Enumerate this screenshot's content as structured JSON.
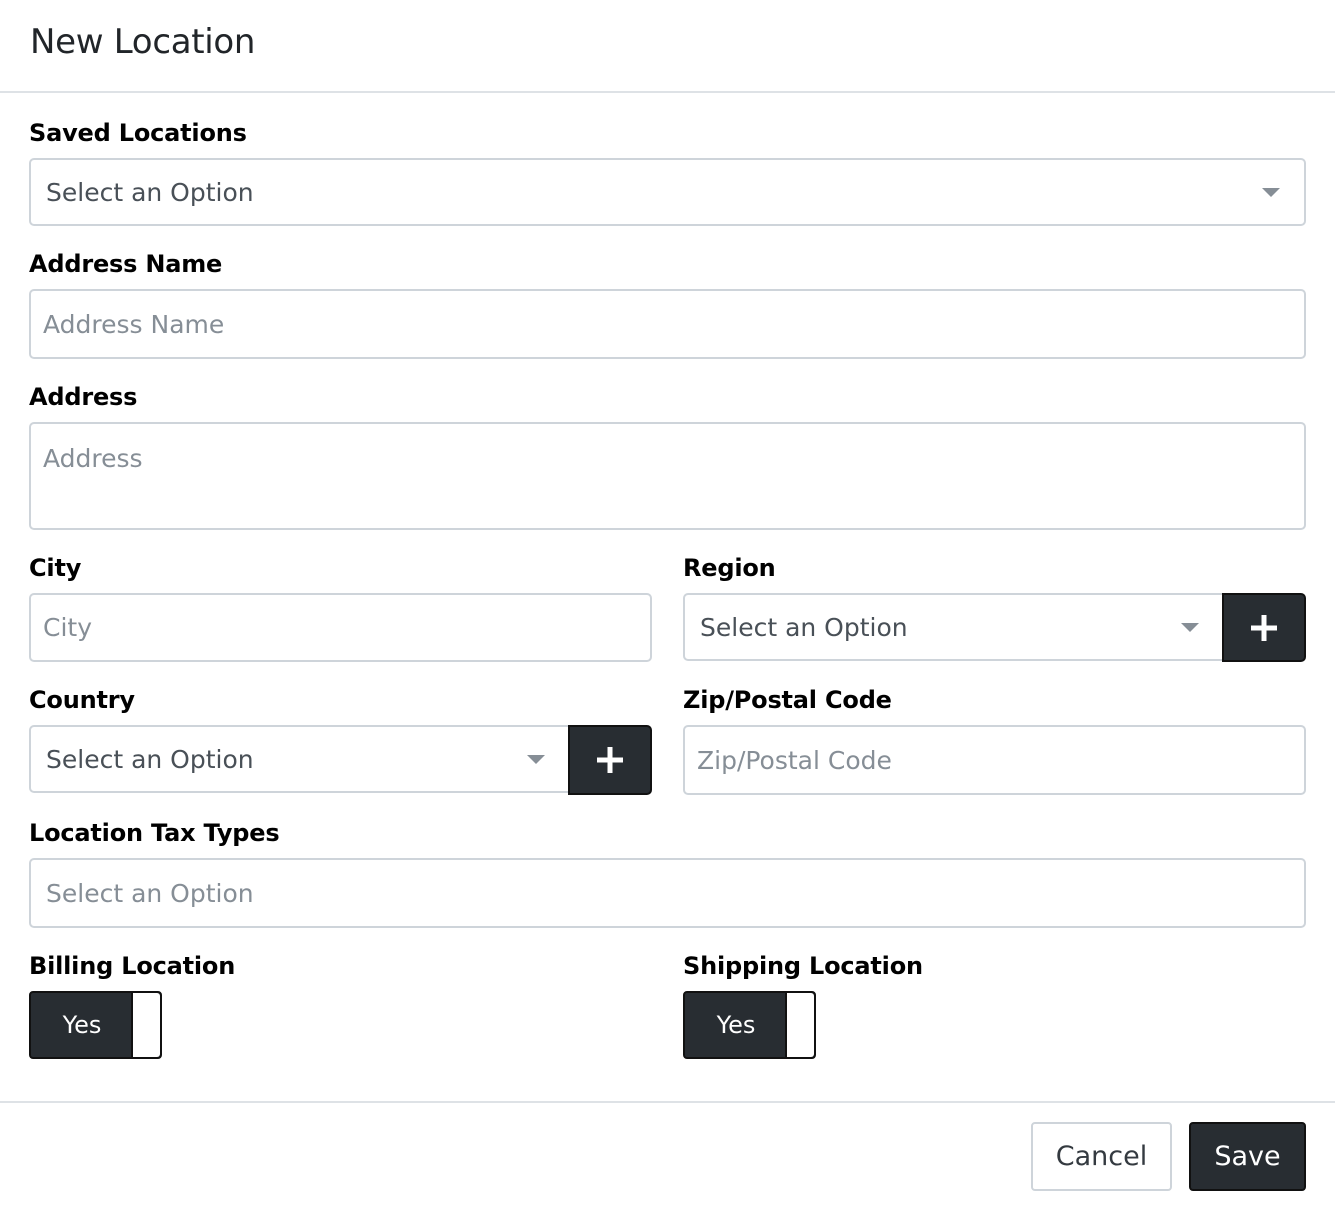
{
  "modal": {
    "title": "New Location"
  },
  "form": {
    "saved_locations": {
      "label": "Saved Locations",
      "value": "Select an Option"
    },
    "address_name": {
      "label": "Address Name",
      "placeholder": "Address Name"
    },
    "address": {
      "label": "Address",
      "placeholder": "Address"
    },
    "city": {
      "label": "City",
      "placeholder": "City"
    },
    "region": {
      "label": "Region",
      "value": "Select an Option"
    },
    "country": {
      "label": "Country",
      "value": "Select an Option"
    },
    "zip": {
      "label": "Zip/Postal Code",
      "placeholder": "Zip/Postal Code"
    },
    "tax_types": {
      "label": "Location Tax Types",
      "placeholder": "Select an Option"
    },
    "billing": {
      "label": "Billing Location",
      "toggle_text": "Yes"
    },
    "shipping": {
      "label": "Shipping Location",
      "toggle_text": "Yes"
    }
  },
  "footer": {
    "cancel_label": "Cancel",
    "save_label": "Save"
  },
  "icons": {
    "dropdown": "chevron-down-icon",
    "add": "plus-icon"
  },
  "colors": {
    "dark_button": "#282d32",
    "border": "#ced4da",
    "placeholder": "#868e96"
  }
}
